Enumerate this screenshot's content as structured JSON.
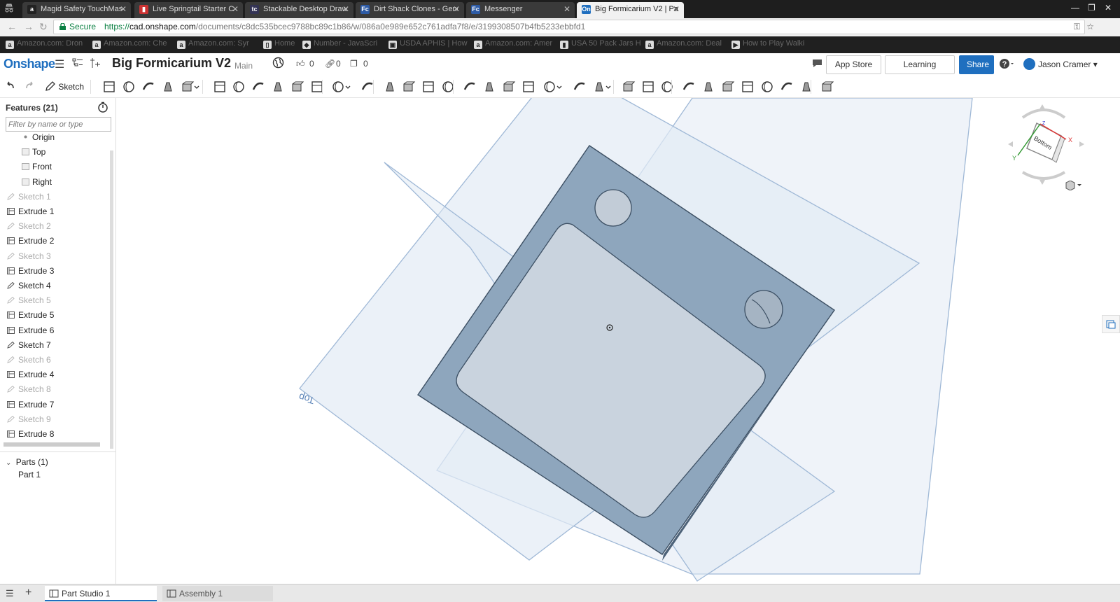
{
  "browser": {
    "tabs": [
      {
        "title": "Magid Safety TouchMas",
        "favicon": "a",
        "favcolor": "#222"
      },
      {
        "title": "Live Springtail Starter C",
        "favicon": "▮",
        "favcolor": "#c33"
      },
      {
        "title": "Stackable Desktop Draw",
        "favicon": "tc",
        "favcolor": "#335"
      },
      {
        "title": "Dirt Shack Clones - Gene",
        "favicon": "Fc",
        "favcolor": "#2d5ba6"
      },
      {
        "title": "Messenger",
        "favicon": "Fc",
        "favcolor": "#2d5ba6"
      },
      {
        "title": "Big Formicarium V2 | Pa",
        "favicon": "On",
        "favcolor": "#1f6fbf"
      }
    ],
    "secure_label": "Secure",
    "url_scheme": "https://",
    "url_host": "cad.onshape.com",
    "url_path": "/documents/c8dc535bcec9788bc89c1b86/w/086a0e989e652c761adfa7f8/e/3199308507b4fb5233ebbfd1",
    "bookmarks": [
      {
        "label": "Amazon.com: Dron",
        "icon": "a"
      },
      {
        "label": "Amazon.com: Che",
        "icon": "a"
      },
      {
        "label": "Amazon.com: Syr",
        "icon": "a"
      },
      {
        "label": "Home",
        "icon": "▯"
      },
      {
        "label": "Number - JavaScri",
        "icon": "◆"
      },
      {
        "label": "USDA APHIS | How",
        "icon": "▣"
      },
      {
        "label": "Amazon.com: Amer",
        "icon": "a"
      },
      {
        "label": "USA 50 Pack Jars H",
        "icon": "▮"
      },
      {
        "label": "Amazon.com: Deal",
        "icon": "a"
      },
      {
        "label": "How to Play Walki",
        "icon": "▶"
      }
    ]
  },
  "header": {
    "logo": "Onshape",
    "doc_title": "Big Formicarium V2",
    "workspace": "Main",
    "likes": "0",
    "links": "0",
    "copies": "0",
    "app_store": "App Store",
    "learning_center": "Learning Center",
    "share": "Share",
    "help": "?",
    "user": "Jason Cramer"
  },
  "toolbar": {
    "sketch_label": "Sketch"
  },
  "features": {
    "header": "Features (21)",
    "filter_placeholder": "Filter by name or type",
    "items": [
      {
        "label": "Origin",
        "type": "origin",
        "suppressed": false
      },
      {
        "label": "Top",
        "type": "plane",
        "suppressed": false
      },
      {
        "label": "Front",
        "type": "plane",
        "suppressed": false
      },
      {
        "label": "Right",
        "type": "plane",
        "suppressed": false
      },
      {
        "label": "Sketch 1",
        "type": "sketch",
        "suppressed": true
      },
      {
        "label": "Extrude 1",
        "type": "extrude",
        "suppressed": false
      },
      {
        "label": "Sketch 2",
        "type": "sketch",
        "suppressed": true
      },
      {
        "label": "Extrude 2",
        "type": "extrude",
        "suppressed": false
      },
      {
        "label": "Sketch 3",
        "type": "sketch",
        "suppressed": true
      },
      {
        "label": "Extrude 3",
        "type": "extrude",
        "suppressed": false
      },
      {
        "label": "Sketch 4",
        "type": "sketch",
        "suppressed": false
      },
      {
        "label": "Sketch 5",
        "type": "sketch",
        "suppressed": true
      },
      {
        "label": "Extrude 5",
        "type": "extrude",
        "suppressed": false
      },
      {
        "label": "Extrude 6",
        "type": "extrude",
        "suppressed": false
      },
      {
        "label": "Sketch 7",
        "type": "sketch",
        "suppressed": false
      },
      {
        "label": "Sketch 6",
        "type": "sketch",
        "suppressed": true
      },
      {
        "label": "Extrude 4",
        "type": "extrude",
        "suppressed": false
      },
      {
        "label": "Sketch 8",
        "type": "sketch",
        "suppressed": true
      },
      {
        "label": "Extrude 7",
        "type": "extrude",
        "suppressed": false
      },
      {
        "label": "Sketch 9",
        "type": "sketch",
        "suppressed": true
      },
      {
        "label": "Extrude 8",
        "type": "extrude",
        "suppressed": false
      }
    ]
  },
  "parts": {
    "header": "Parts (1)",
    "items": [
      "Part 1"
    ]
  },
  "viewport": {
    "plane_label": "Top",
    "view_cube_face": "Bottom",
    "axis_x": "X",
    "axis_y": "Y",
    "axis_z": "Z"
  },
  "bottom_tabs": [
    {
      "label": "Part Studio 1",
      "active": true
    },
    {
      "label": "Assembly 1",
      "active": false
    }
  ]
}
